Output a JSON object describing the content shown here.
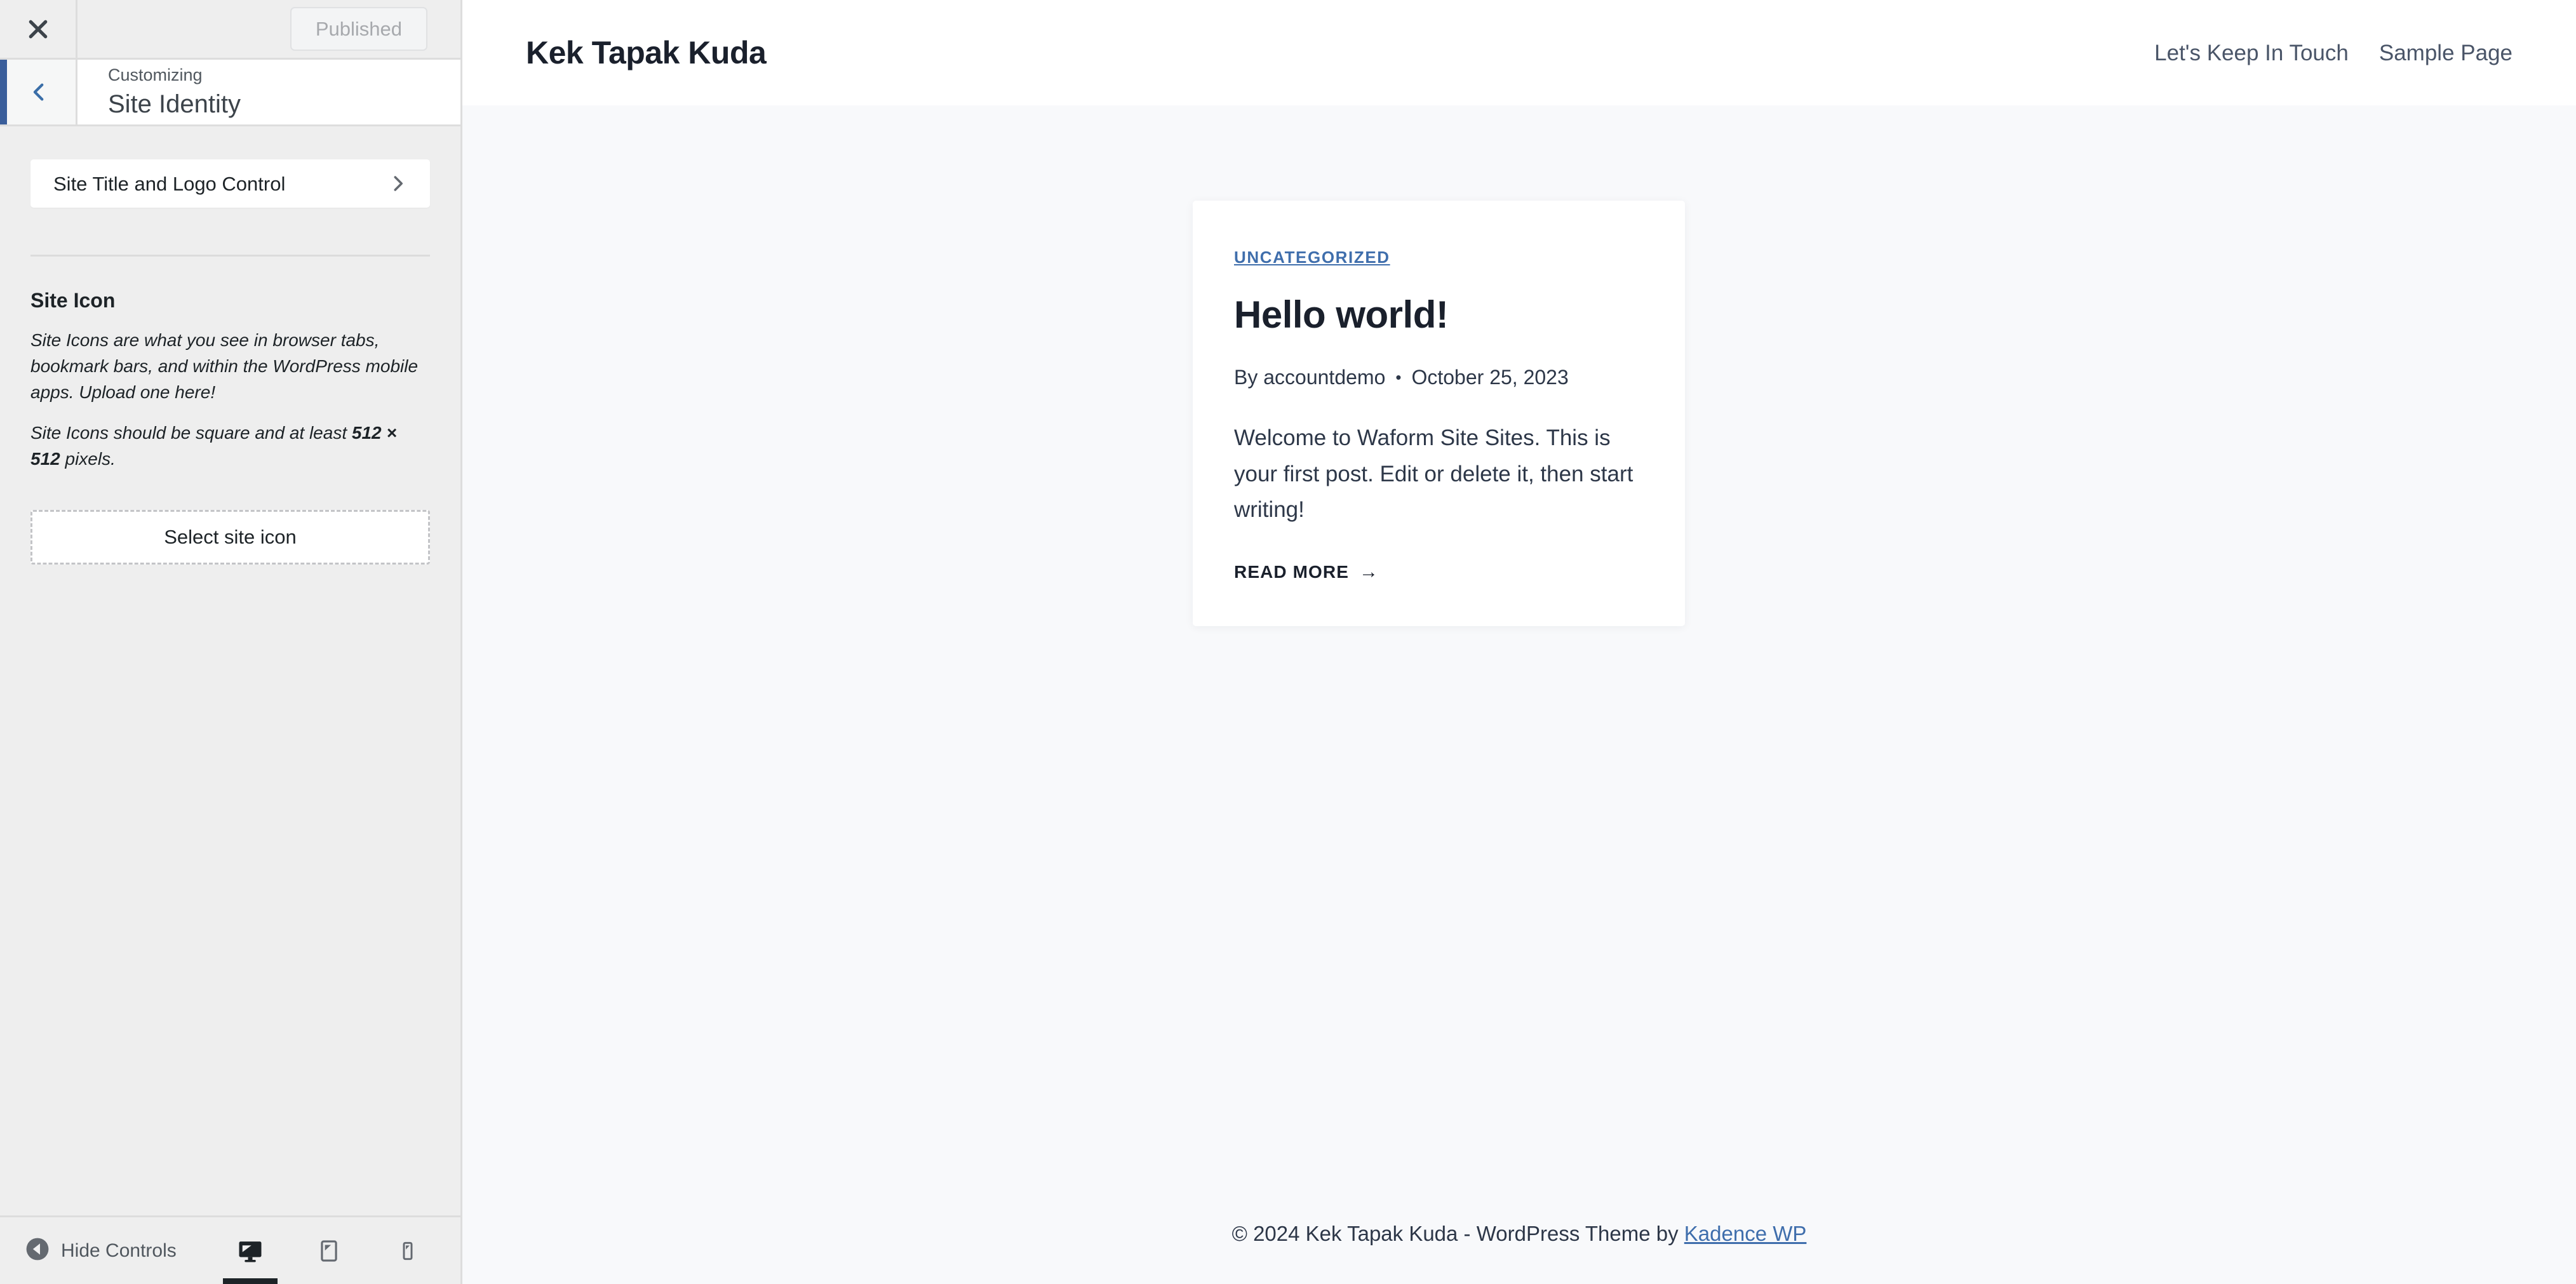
{
  "customizer": {
    "close_icon": "close-x-icon",
    "publish_button_label": "Published",
    "back_icon": "chevron-left-icon",
    "breadcrumb_label": "Customizing",
    "panel_title": "Site Identity",
    "sub_control": {
      "label": "Site Title and Logo Control",
      "chevron_icon": "chevron-right-icon"
    },
    "site_icon_section": {
      "title": "Site Icon",
      "description_1": "Site Icons are what you see in browser tabs, bookmark bars, and within the WordPress mobile apps. Upload one here!",
      "description_2_prefix": "Site Icons should be square and at least ",
      "description_2_bold": "512 × 512",
      "description_2_suffix": " pixels.",
      "select_button_label": "Select site icon"
    },
    "footer": {
      "hide_controls_label": "Hide Controls",
      "hide_controls_icon": "collapse-left-circle-icon",
      "devices": [
        {
          "name": "desktop",
          "icon": "desktop-icon",
          "active": true
        },
        {
          "name": "tablet",
          "icon": "tablet-icon",
          "active": false
        },
        {
          "name": "mobile",
          "icon": "mobile-icon",
          "active": false
        }
      ]
    },
    "accent_color": "#3a5e9b"
  },
  "preview": {
    "site_title": "Kek Tapak Kuda",
    "nav": [
      {
        "label": "Let's Keep In Touch"
      },
      {
        "label": "Sample Page"
      }
    ],
    "post": {
      "category": "UNCATEGORIZED",
      "title": "Hello world!",
      "author": "By accountdemo",
      "meta_separator": "•",
      "date": "October 25, 2023",
      "excerpt": "Welcome to Waform Site Sites. This is your first post. Edit or delete it, then start writing!",
      "read_more_label": "READ MORE",
      "read_more_arrow": "→",
      "category_color": "#3f6eac"
    },
    "footer": {
      "text": "© 2024 Kek Tapak Kuda - WordPress Theme by ",
      "link_label": "Kadence WP"
    }
  }
}
